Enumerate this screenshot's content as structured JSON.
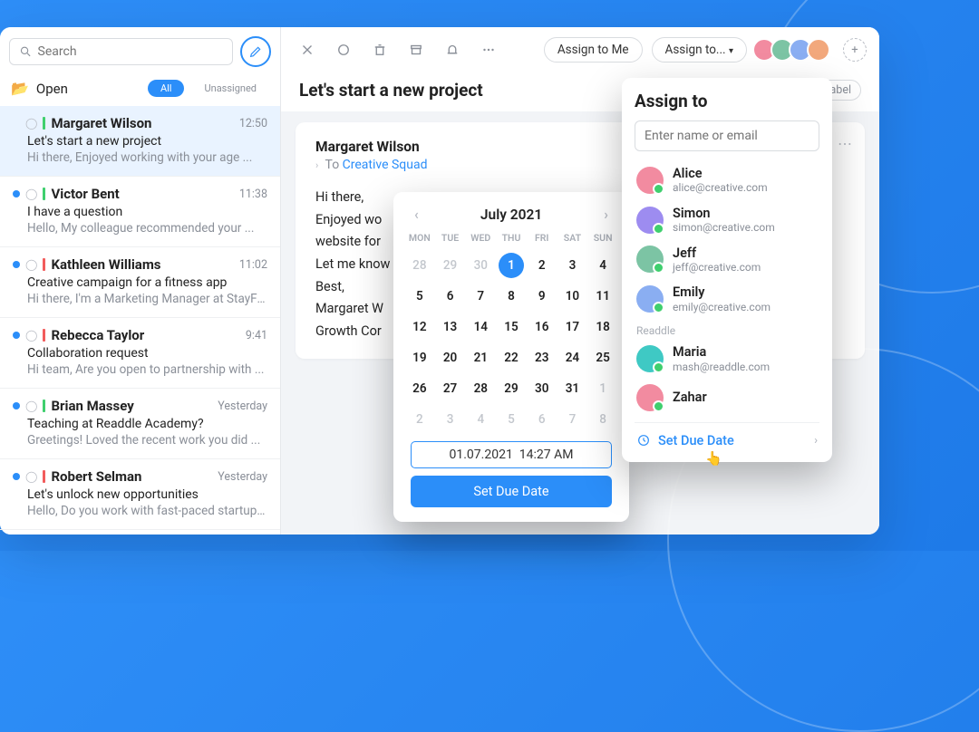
{
  "search": {
    "placeholder": "Search"
  },
  "folder": {
    "name": "Open",
    "filters": {
      "all": "All",
      "unassigned": "Unassigned"
    }
  },
  "threads": [
    {
      "sender": "Margaret Wilson",
      "time": "12:50",
      "subject": "Let's start a new project",
      "preview": "Hi there, Enjoyed working with your age ...",
      "bar": "green",
      "selected": true,
      "dot": false
    },
    {
      "sender": "Victor Bent",
      "time": "11:38",
      "subject": "I have a question",
      "preview": "Hello, My colleague recommended your ...",
      "bar": "green",
      "dot": true
    },
    {
      "sender": "Kathleen Williams",
      "time": "11:02",
      "subject": "Creative campaign for a fitness app",
      "preview": "Hi there, I'm a Marketing Manager at StayFit ...",
      "bar": "red",
      "dot": true
    },
    {
      "sender": "Rebecca Taylor",
      "time": "9:41",
      "subject": "Collaboration request",
      "preview": "Hi team, Are you open to partnership with ...",
      "bar": "red",
      "dot": true
    },
    {
      "sender": "Brian Massey",
      "time": "Yesterday",
      "subject": "Teaching at Readdle Academy?",
      "preview": "Greetings! Loved the recent work you did ...",
      "bar": "green",
      "dot": true
    },
    {
      "sender": "Robert Selman",
      "time": "Yesterday",
      "subject": "Let's unlock new opportunities",
      "preview": "Hello, Do you work with fast-paced startups?",
      "bar": "red",
      "dot": true
    }
  ],
  "toolbar": {
    "assign_me": "Assign to Me",
    "assign_to": "Assign to...",
    "add_label": "Add label"
  },
  "message": {
    "title": "Let's start a new project",
    "from": "Margaret Wilson",
    "to_prefix": "To ",
    "to_name": "Creative Squad",
    "body_lines": [
      "Hi there,",
      "Enjoyed wo",
      "website for",
      "Let me know",
      "Best,",
      "Margaret W",
      "Growth Cor"
    ]
  },
  "assign": {
    "title": "Assign to",
    "placeholder": "Enter name or email",
    "people": [
      {
        "name": "Alice",
        "email": "alice@creative.com",
        "color": "#f28ba0"
      },
      {
        "name": "Simon",
        "email": "simon@creative.com",
        "color": "#9d8cf0"
      },
      {
        "name": "Jeff",
        "email": "jeff@creative.com",
        "color": "#7cc4a4"
      },
      {
        "name": "Emily",
        "email": "emily@creative.com",
        "color": "#8aaef2"
      }
    ],
    "group_label": "Readdle",
    "group_people": [
      {
        "name": "Maria",
        "email": "mash@readdle.com",
        "color": "#3fc9c4"
      },
      {
        "name": "Zahar",
        "email": "",
        "color": "#f28ba0"
      }
    ],
    "due_label": "Set Due Date"
  },
  "datepicker": {
    "month": "July 2021",
    "dow": [
      "MON",
      "TUE",
      "WED",
      "THU",
      "FRI",
      "SAT",
      "SUN"
    ],
    "leading": [
      28,
      29,
      30
    ],
    "days": 31,
    "selected": 1,
    "trailing": [
      1,
      2,
      3,
      4,
      5,
      6,
      7,
      8
    ],
    "input_value": "01.07.2021  14:27 AM",
    "button": "Set Due Date"
  }
}
